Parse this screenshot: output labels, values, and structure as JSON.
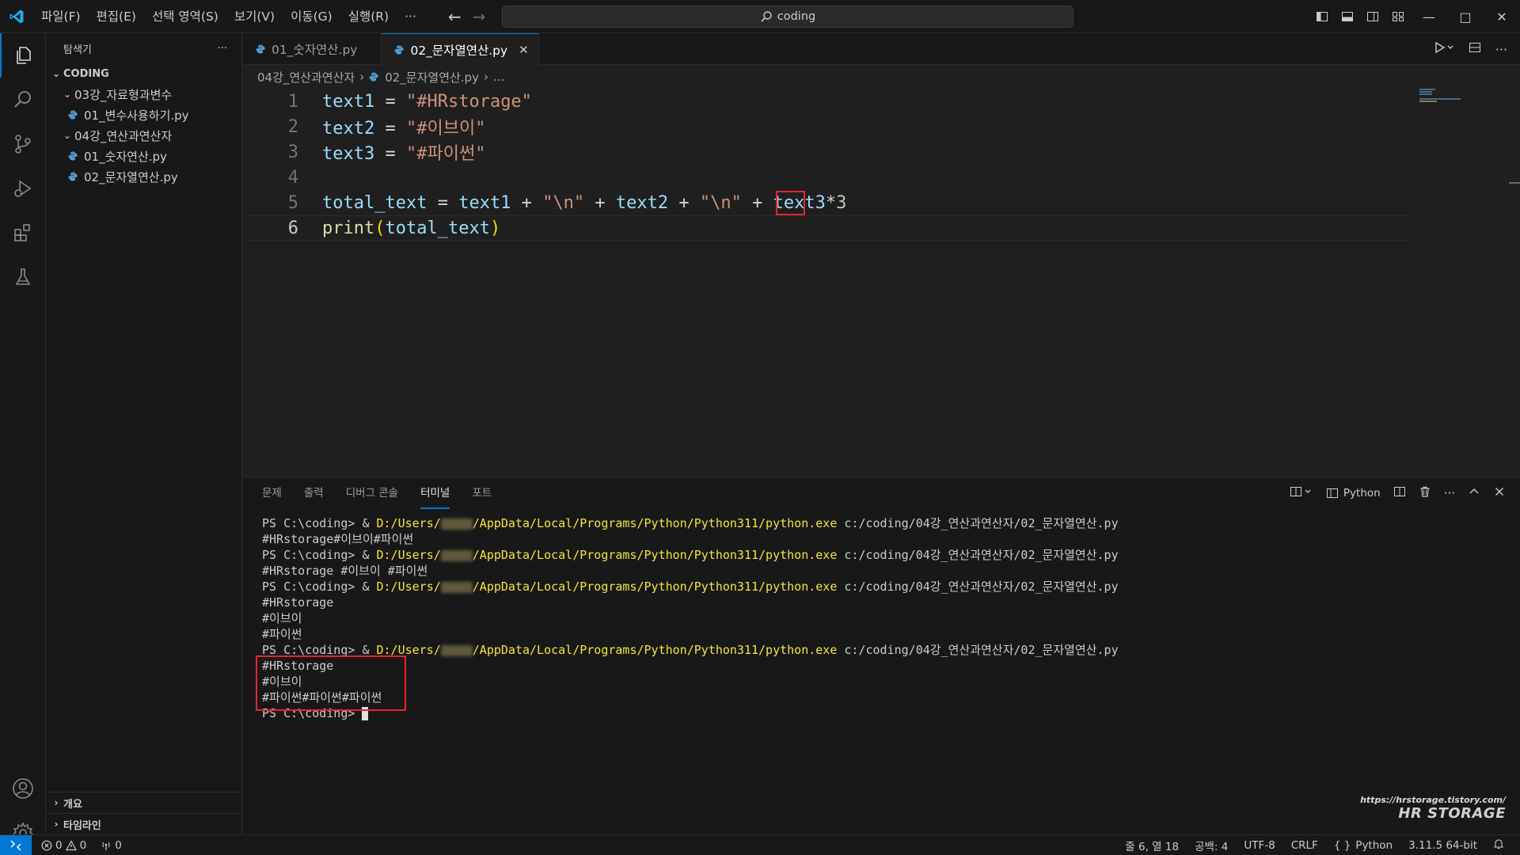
{
  "menu": [
    "파일(F)",
    "편집(E)",
    "선택 영역(S)",
    "보기(V)",
    "이동(G)",
    "실행(R)",
    "···"
  ],
  "search": {
    "text": "coding"
  },
  "sidebar": {
    "title": "탐색기",
    "more": "···",
    "root": "CODING",
    "items": [
      {
        "label": "03강_자료형과변수"
      },
      {
        "label": "01_변수사용하기.py"
      },
      {
        "label": "04강_연산과연산자"
      },
      {
        "label": "01_숫자연산.py"
      },
      {
        "label": "02_문자열연산.py"
      }
    ],
    "outline": "개요",
    "timeline": "타임라인"
  },
  "tabs": [
    {
      "label": "01_숫자연산.py"
    },
    {
      "label": "02_문자열연산.py"
    }
  ],
  "breadcrumb": {
    "folder": "04강_연산과연산자",
    "file": "02_문자열연산.py",
    "more": "..."
  },
  "code": {
    "line_numbers": [
      "1",
      "2",
      "3",
      "4",
      "5",
      "6"
    ],
    "l1_var": "text1",
    "l1_eq": " = ",
    "l1_str": "\"#HRstorage\"",
    "l2_var": "text2",
    "l2_eq": " = ",
    "l2_str": "\"#이브이\"",
    "l3_var": "text3",
    "l3_eq": " = ",
    "l3_str": "\"#파이썬\"",
    "l5_a": "total_text",
    "l5_b": " = ",
    "l5_c": "text1",
    "l5_d": " + ",
    "l5_e": "\"\\n\"",
    "l5_f": " + ",
    "l5_g": "text2",
    "l5_h": " + ",
    "l5_i": "\"\\n\"",
    "l5_j": " + ",
    "l5_k": "text3",
    "l5_l": "*",
    "l5_m": "3",
    "l6_fn": "print",
    "l6_open": "(",
    "l6_arg": "total_text",
    "l6_close": ")"
  },
  "panel": {
    "tabs": [
      "문제",
      "출력",
      "디버그 콘솔",
      "터미널",
      "포트"
    ],
    "shell": "Python"
  },
  "terminal": {
    "prompt": "PS C:\\coding> ",
    "amp": "& ",
    "exe_a": "D:/Users/",
    "exe_b": "/AppData/Local/Programs/Python/Python311/python.exe",
    "script": " c:/coding/04강_연산과연산자/02_문자열연산.py",
    "out1": "#HRstorage#이브이#파이썬",
    "out2": "#HRstorage #이브이 #파이썬",
    "out3a": "#HRstorage",
    "out3b": "#이브이",
    "out3c": "#파이썬",
    "out4a": "#HRstorage",
    "out4b": "#이브이",
    "out4c": "#파이썬#파이썬#파이썬",
    "last_prompt": "PS C:\\coding> "
  },
  "watermark": {
    "url": "https://hrstorage.tistory.com/",
    "brand": "HR STORAGE"
  },
  "status": {
    "errors": "0",
    "warnings": "0",
    "ports": "0",
    "position": "줄 6, 열 18",
    "spaces": "공백: 4",
    "encoding": "UTF-8",
    "eol": "CRLF",
    "language": "Python",
    "interpreter": "3.11.5 64-bit"
  },
  "colors": {
    "accent": "#0078d4",
    "highlight": "#e3262f"
  }
}
